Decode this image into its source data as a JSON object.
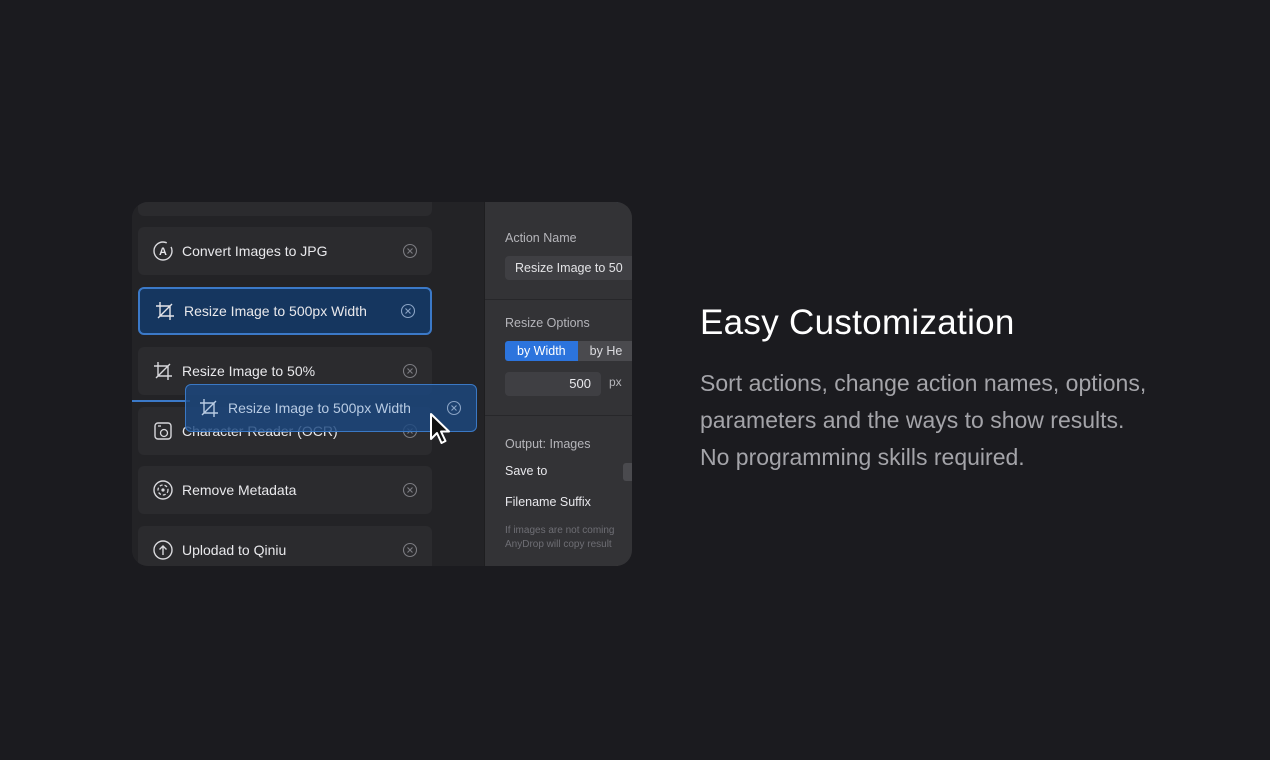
{
  "actions": [
    {
      "label": "Convert Images to JPG",
      "icon": "convert-jpg-icon"
    },
    {
      "label": "Resize Image to 500px Width",
      "icon": "crop-icon",
      "selected": true
    },
    {
      "label": "Resize Image to 50%",
      "icon": "crop-icon"
    },
    {
      "label": "Character Reader (OCR)",
      "icon": "ocr-icon"
    },
    {
      "label": "Remove Metadata",
      "icon": "metadata-icon"
    },
    {
      "label": "Uplodad to Qiniu",
      "icon": "upload-icon"
    }
  ],
  "dragging": {
    "label": "Resize Image to 500px Width",
    "icon": "crop-icon"
  },
  "settings": {
    "action_name_label": "Action Name",
    "action_name_value": "Resize Image to 50",
    "resize_options_label": "Resize Options",
    "seg_by_width": "by Width",
    "seg_by_height": "by He",
    "width_value": "500",
    "unit": "px",
    "output_label": "Output: Images",
    "save_to_label": "Save to",
    "filename_suffix_label": "Filename Suffix",
    "note_line1": "If images are not coming",
    "note_line2": "AnyDrop will copy result"
  },
  "hero": {
    "title": "Easy Customization",
    "lines": [
      "Sort actions, change action names, options,",
      "parameters and the ways to show results.",
      "No programming skills required."
    ]
  },
  "colors": {
    "background": "#1b1b1f",
    "accent": "#2c74dd",
    "selected_card": "#15365f"
  }
}
